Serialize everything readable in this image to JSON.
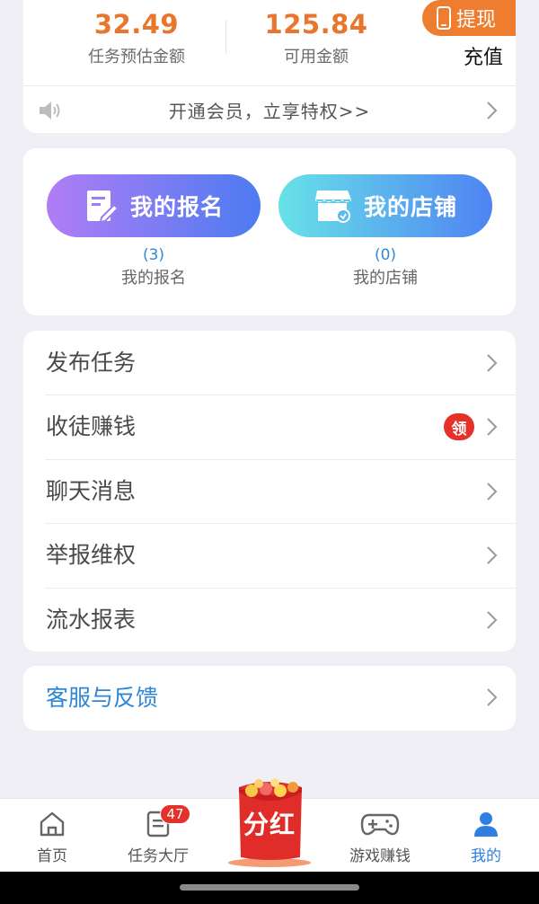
{
  "balance": {
    "estimate_value": "32.49",
    "estimate_label": "任务预估金额",
    "available_value": "125.84",
    "available_label": "可用金额",
    "withdraw_label": "提现",
    "recharge_label": "充值"
  },
  "notice": {
    "text": "开通会员，立享特权>>"
  },
  "shortcuts": {
    "signups": {
      "button_label": "我的报名",
      "count": "(3)",
      "label": "我的报名"
    },
    "shop": {
      "button_label": "我的店铺",
      "count": "(0)",
      "label": "我的店铺"
    }
  },
  "menu": {
    "items": [
      {
        "label": "发布任务"
      },
      {
        "label": "收徒赚钱",
        "badge": "领"
      },
      {
        "label": "聊天消息"
      },
      {
        "label": "举报维权"
      },
      {
        "label": "流水报表"
      }
    ]
  },
  "service": {
    "label": "客服与反馈"
  },
  "nav": {
    "home": {
      "label": "首页",
      "icon": "home-icon"
    },
    "hall": {
      "label": "任务大厅",
      "icon": "task-list-icon",
      "badge": "47"
    },
    "dividend": {
      "label": "分红",
      "icon": "red-envelope-icon"
    },
    "game": {
      "label": "游戏赚钱",
      "icon": "gamepad-icon"
    },
    "mine": {
      "label": "我的",
      "icon": "user-icon",
      "active": true
    }
  },
  "colors": {
    "accent_orange": "#ef7d2f",
    "value_orange": "#e8762c",
    "link_blue": "#2f86d6",
    "nav_active": "#2f7fe0",
    "badge_red": "#e4312b"
  }
}
